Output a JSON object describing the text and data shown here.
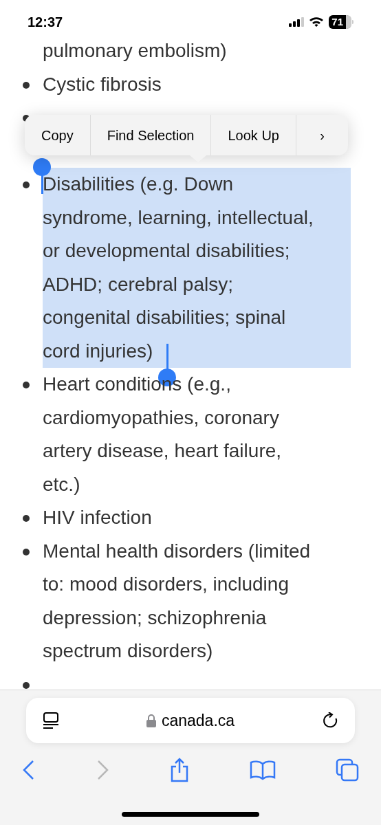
{
  "status_bar": {
    "time": "12:37",
    "battery": "71"
  },
  "list": {
    "items": [
      {
        "kind": "continuation",
        "text": "pulmonary embolism)",
        "selected": false
      },
      {
        "kind": "bullet",
        "text": "Cystic fibrosis",
        "selected": false
      },
      {
        "kind": "covered",
        "selected": false
      },
      {
        "kind": "bullet",
        "text": "Disabilities (e.g. Down syndrome, learning, intellectual, or developmental disabilities; ADHD; cerebral palsy; congenital disabilities; spinal cord injuries)",
        "selected": true
      },
      {
        "kind": "bullet",
        "text": "Heart conditions (e.g., cardiomyopathies, coronary artery disease, heart failure, etc.)",
        "selected": false
      },
      {
        "kind": "bullet",
        "text": "HIV infection",
        "selected": false
      },
      {
        "kind": "bullet",
        "text": "Mental health disorders (limited to: mood disorders, including depression; schizophrenia spectrum disorders)",
        "selected": false
      },
      {
        "kind": "cut",
        "selected": false
      }
    ]
  },
  "context_menu": {
    "items": [
      "Copy",
      "Find Selection",
      "Look Up",
      "›"
    ]
  },
  "address_bar": {
    "url": "canada.ca"
  },
  "toolbar": {
    "back": {
      "disabled": false
    },
    "forward": {
      "disabled": true
    }
  }
}
